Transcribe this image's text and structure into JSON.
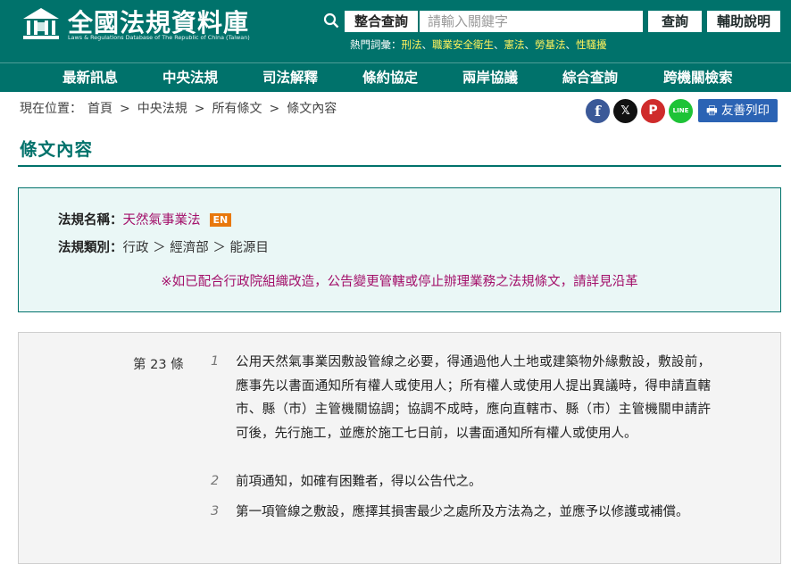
{
  "header": {
    "site_title": "全國法規資料庫",
    "site_subtitle": "Laws & Regulations Database of The Republic of China (Taiwan)"
  },
  "search": {
    "scope_label": "整合查詢",
    "placeholder": "請輸入關鍵字",
    "submit_label": "查詢",
    "help_label": "輔助說明",
    "hot_label": "熱門詞彙：",
    "hot_keywords": [
      "刑法",
      "職業安全衛生",
      "憲法",
      "勞基法",
      "性騷擾"
    ]
  },
  "nav": {
    "items": [
      "最新訊息",
      "中央法規",
      "司法解釋",
      "條約協定",
      "兩岸協議",
      "綜合查詢",
      "跨機關檢索"
    ]
  },
  "breadcrumb": {
    "prefix": "現在位置：",
    "items": [
      "首頁",
      "中央法規",
      "所有條文",
      "條文內容"
    ],
    "separator": ">"
  },
  "share": {
    "facebook": "f",
    "x": "𝕏",
    "plurk": "P",
    "line": "LINE",
    "print_label": "友善列印"
  },
  "page": {
    "section_title": "條文內容"
  },
  "law_info": {
    "name_label": "法規名稱：",
    "name": "天然氣事業法",
    "en_badge": "EN",
    "category_label": "法規類別：",
    "category": "行政 ＞ 經濟部 ＞ 能源目",
    "notice": "※如已配合行政院組織改造，公告變更管轄或停止辦理業務之法規條文，請詳見沿革"
  },
  "article": {
    "number": "第 23 條",
    "paragraphs": [
      {
        "num": "1",
        "text": "公用天然氣事業因敷設管線之必要，得通過他人土地或建築物外緣敷設，敷設前，應事先以書面通知所有權人或使用人；所有權人或使用人提出異議時，得申請直轄市、縣（市）主管機關協調；協調不成時，應向直轄市、縣（市）主管機關申請許可後，先行施工，並應於施工七日前，以書面通知所有權人或使用人。"
      },
      {
        "num": "2",
        "text": "前項通知，如確有困難者，得以公告代之。"
      },
      {
        "num": "3",
        "text": "第一項管線之敷設，應擇其損害最少之處所及方法為之，並應予以修護或補償。"
      }
    ]
  },
  "colors": {
    "primary": "#00726b",
    "link": "#a3106a",
    "hot_keyword": "#fff25c",
    "print_button": "#2b63b4",
    "en_badge": "#e8780c"
  }
}
